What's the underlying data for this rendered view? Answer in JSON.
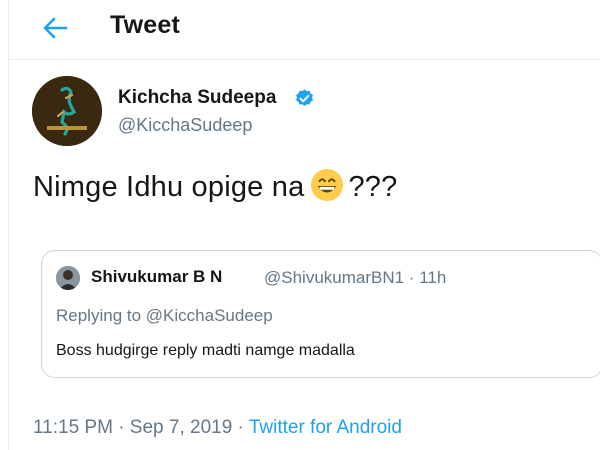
{
  "header": {
    "back_icon": "arrow-left-icon",
    "title": "Tweet"
  },
  "tweet": {
    "author": {
      "name": "Kichcha Sudeepa",
      "handle": "@KicchaSudeep",
      "verified_icon": "verified-badge-icon"
    },
    "text_before_emoji": "Nimge Idhu opige na",
    "emoji": "grinning-face-emoji",
    "text_after_emoji": "???",
    "quoted": {
      "name": "Shivukumar B N",
      "handle_time": "@ShivukumarBN1 · 11h",
      "replying_prefix": "Replying to",
      "replying_mention": "@KicchaSudeep",
      "text": "Boss hudgirge reply madti namge madalla"
    },
    "meta": {
      "time_date": "11:15 PM · Sep 7, 2019 ·",
      "source": "Twitter for Android"
    }
  },
  "colors": {
    "accent": "#1da1f2",
    "text_primary": "#14171a",
    "text_secondary": "#657786",
    "border": "#ccd6dd"
  }
}
